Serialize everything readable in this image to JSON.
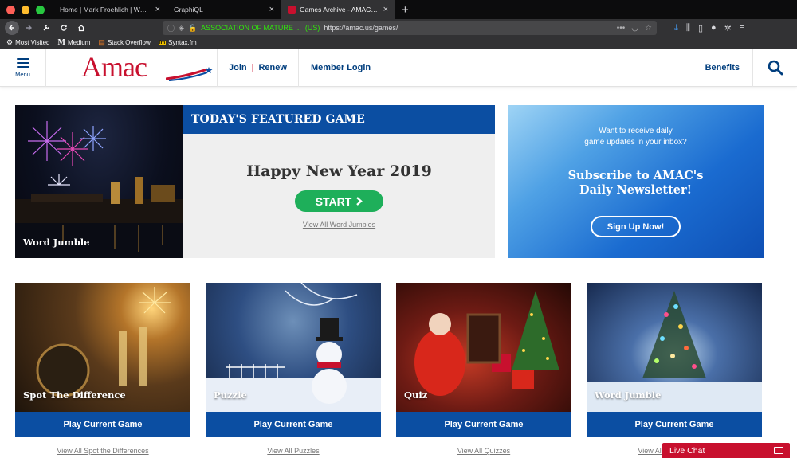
{
  "browser": {
    "tabs": [
      {
        "title": "Home | Mark Froehlich | Web Dev"
      },
      {
        "title": "GraphiQL"
      },
      {
        "title": "Games Archive - AMAC - The A"
      }
    ],
    "new_tab_label": "+",
    "url_org": "ASSOCIATION OF MATURE ...",
    "url_country": "(US)",
    "url": "https://amac.us/games/",
    "bookmarks": [
      {
        "label": "Most Visited",
        "icon": "gear-icon"
      },
      {
        "label": "Medium",
        "icon": "medium-icon"
      },
      {
        "label": "Stack Overflow",
        "icon": "stackoverflow-icon"
      },
      {
        "label": "Syntax.fm",
        "icon": "syntax-icon"
      }
    ]
  },
  "header": {
    "menu_label": "Menu",
    "logo_text": "Amac",
    "join_label": "Join",
    "renew_label": "Renew",
    "login_label": "Member Login",
    "benefits_label": "Benefits"
  },
  "featured": {
    "image_label": "Word Jumble",
    "bar_title": "TODAY'S FEATURED GAME",
    "game_title": "Happy New Year 2019",
    "start_label": "START",
    "view_all_label": "View All Word Jumbles"
  },
  "newsletter": {
    "line1": "Want to receive daily",
    "line2": "game updates in your inbox?",
    "headline1": "Subscribe to AMAC's",
    "headline2": "Daily Newsletter!",
    "button_label": "Sign Up Now!"
  },
  "cards": [
    {
      "label": "Spot The Difference",
      "button": "Play Current Game",
      "link": "View All Spot the Differences"
    },
    {
      "label": "Puzzle",
      "button": "Play Current Game",
      "link": "View All Puzzles"
    },
    {
      "label": "Quiz",
      "button": "Play Current Game",
      "link": "View All Quizzes"
    },
    {
      "label": "Word Jumble",
      "button": "Play Current Game",
      "link": "View All Word Jumbles"
    }
  ],
  "livechat_label": "Live Chat",
  "colors": {
    "brand_blue": "#0b4ea2",
    "brand_red": "#c8102e",
    "start_green": "#1eaf5a"
  }
}
